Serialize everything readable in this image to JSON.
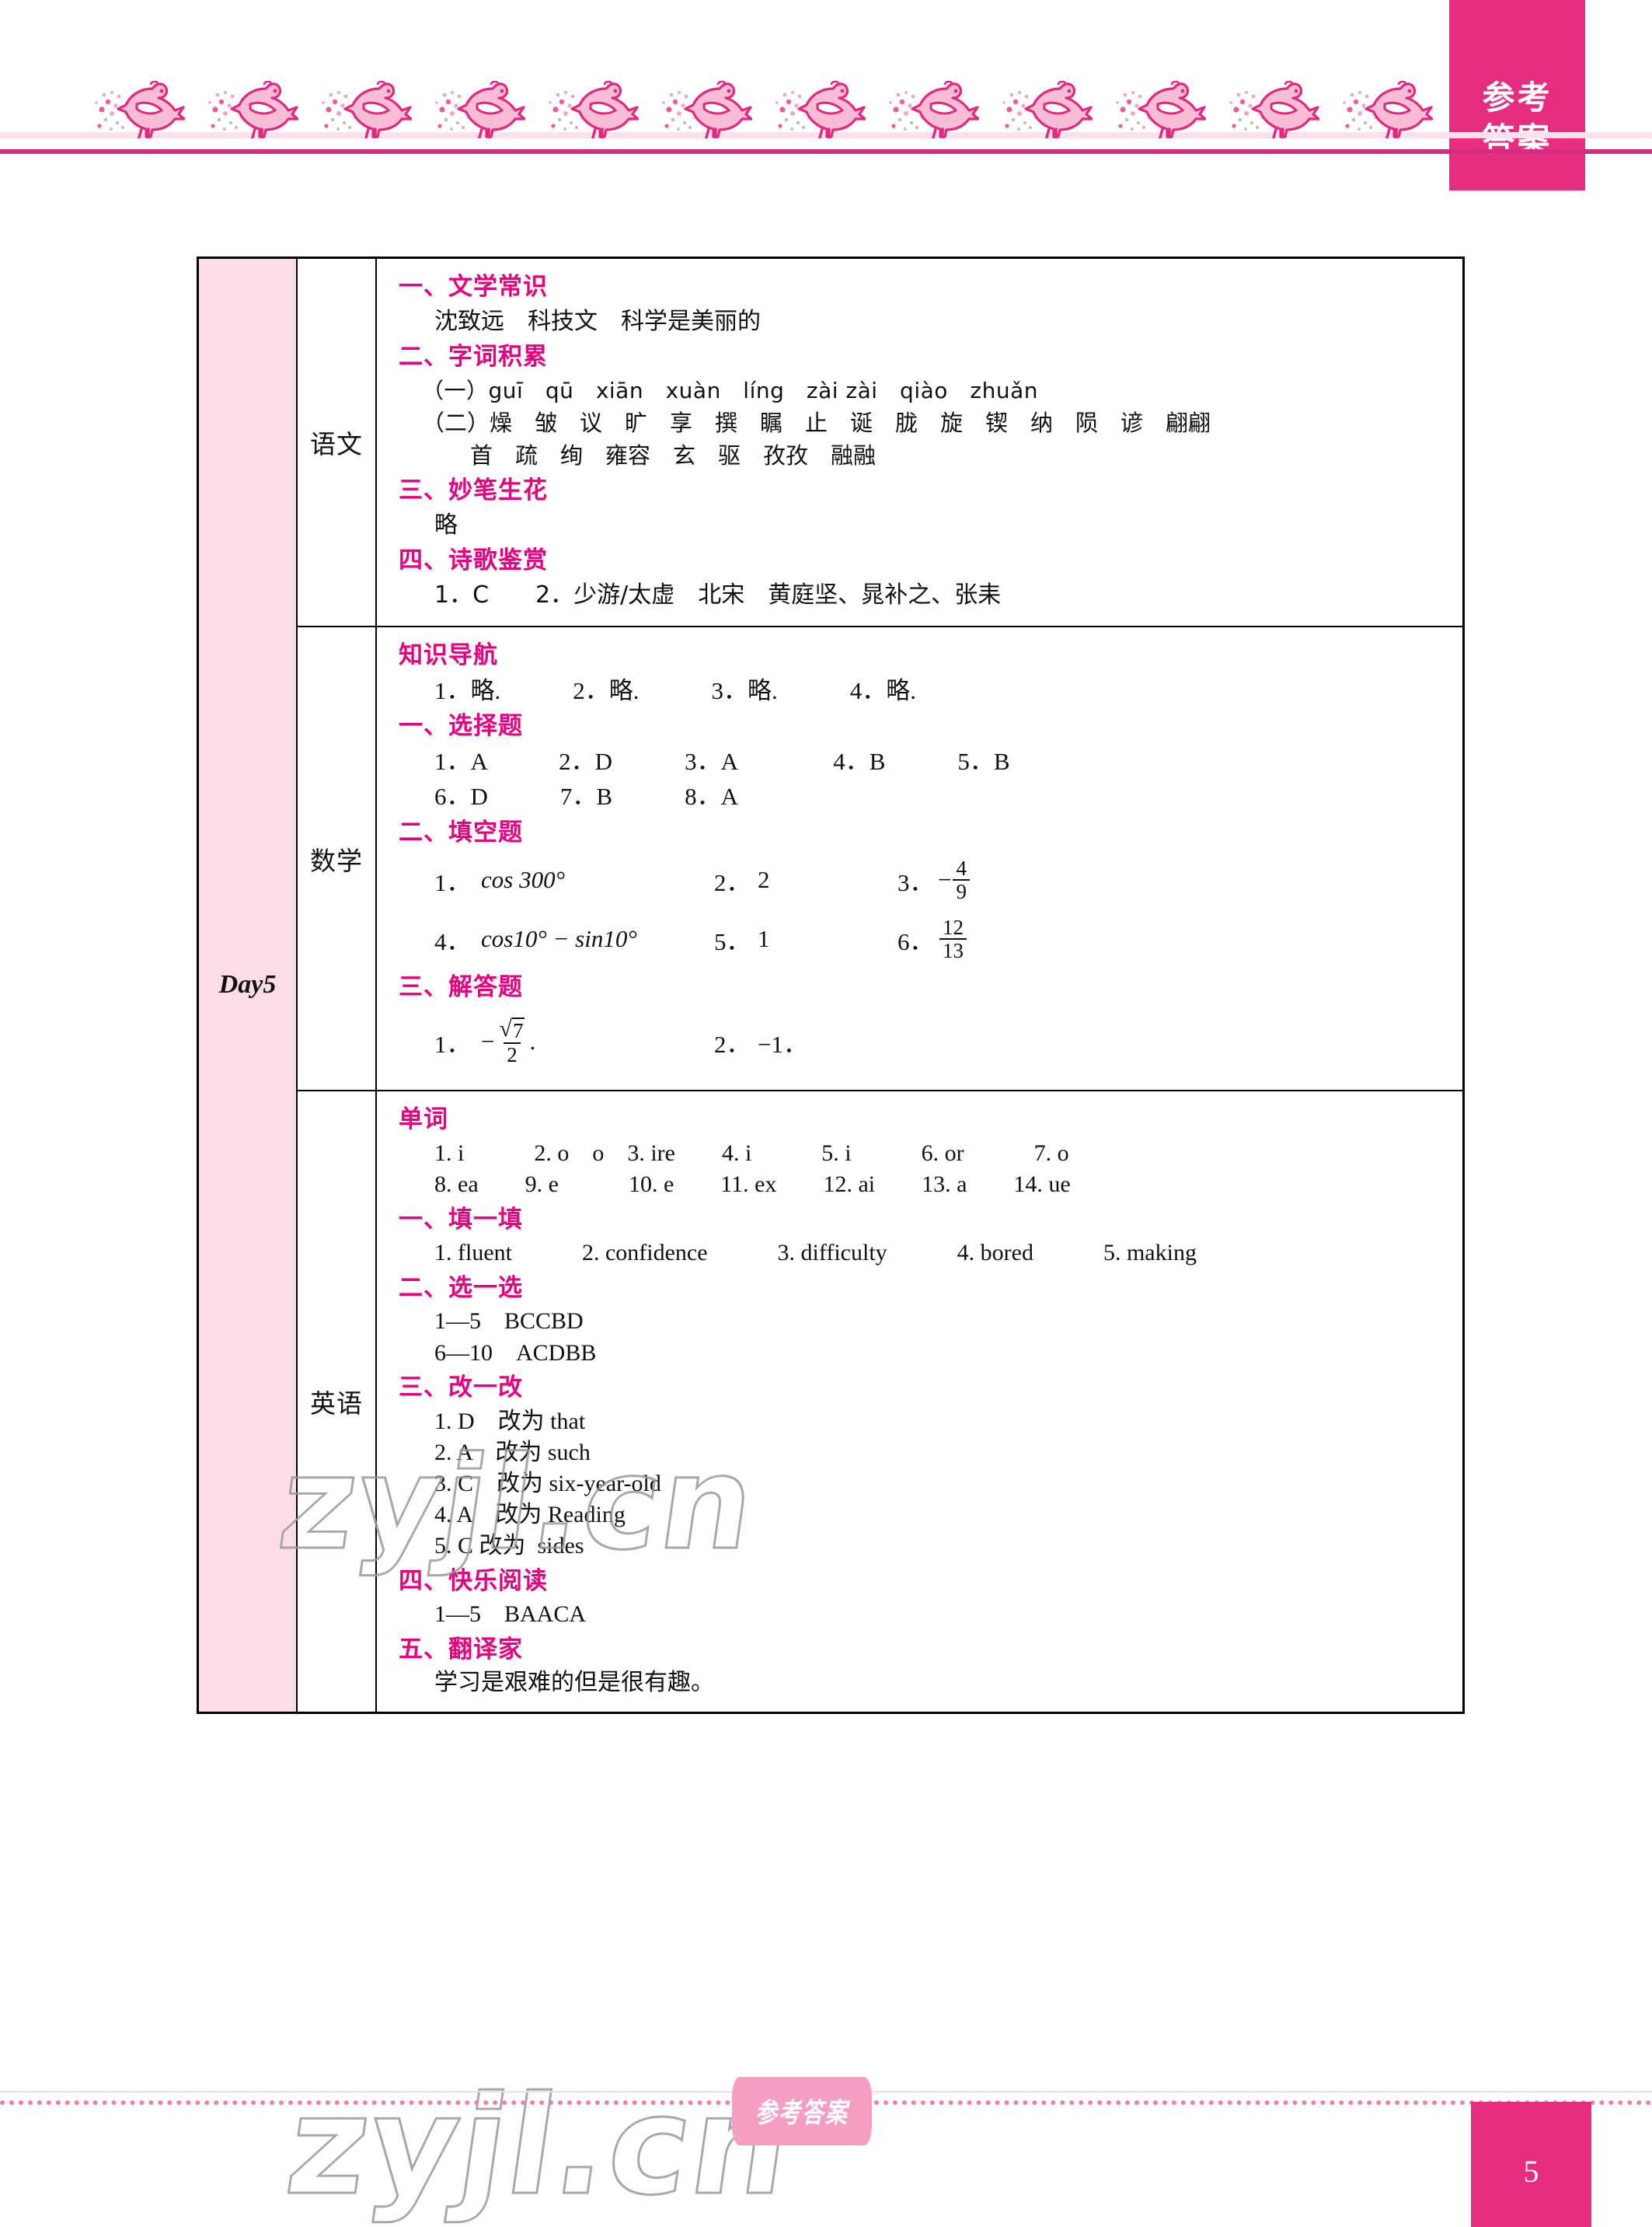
{
  "corner_tab": {
    "line1": "参考",
    "line2": "答案"
  },
  "table": {
    "day_label": "Day5",
    "subjects": {
      "chinese": "语文",
      "math": "数学",
      "english": "英语"
    }
  },
  "chinese": {
    "h1": "一、文学常识",
    "h1_answer": "沈致远　科技文　科学是美丽的",
    "h2": "二、字词积累",
    "pinyin_prefix": "（一）",
    "pinyin": "guī　qū　xiān　xuàn　líng　zài zài　qiào　zhuǎn",
    "hanzi_prefix": "（二）",
    "hanzi_line1": "燥　皱　议　旷　享　撰　瞩　止　诞　胧　旋　锲　纳　陨　谚　翩翩",
    "hanzi_line2": "首　疏　绚　雍容　玄　驱　孜孜　融融",
    "h3": "三、妙笔生花",
    "h3_answer": "略",
    "h4": "四、诗歌鉴赏",
    "h4_answer": "1．C　　2．少游/太虚　北宋　黄庭坚、晁补之、张耒"
  },
  "math": {
    "nav_head": "知识导航",
    "nav_answer": "1．略.　　　2．略.　　　3．略.　　　4．略.",
    "h1": "一、选择题",
    "choice_row1": "1．A　　　2．D　　　3．A　　　　4．B　　　5．B",
    "choice_row2": "6．D　　　7．B　　　8．A",
    "h2": "二、填空题",
    "fill": {
      "q1_label": "1．",
      "q1_value": "cos 300°",
      "q2_label": "2．",
      "q2_value": "2",
      "q3_label": "3．",
      "q3_sign": "−",
      "q3_num": "4",
      "q3_den": "9",
      "q4_label": "4．",
      "q4_value": "cos10° − sin10°",
      "q5_label": "5．",
      "q5_value": "1",
      "q6_label": "6．",
      "q6_num": "12",
      "q6_den": "13"
    },
    "h3": "三、解答题",
    "solve": {
      "q1_label": "1．",
      "q1_sign": "−",
      "q1_num_radical": "√",
      "q1_num_body": "7",
      "q1_den": "2",
      "q1_period": ".",
      "q2_label": "2．",
      "q2_value": "−1．"
    }
  },
  "english": {
    "words_head": "单词",
    "words_row1": "1. i　　　2. o　o　3. ire　　4. i　　　5. i　　　6. or　　　7. o",
    "words_row2": "8. ea　　9. e　　　10. e　　11. ex　　12. ai　　13. a　　14. ue",
    "h1": "一、填一填",
    "h1_answer": "1. fluent　　　2. confidence　　　3. difficulty　　　4. bored　　　5. making",
    "h2": "二、选一选",
    "h2_row1": "1—5　BCCBD",
    "h2_row2": "6—10　ACDBB",
    "h3": "三、改一改",
    "h3_rows": [
      "1. D　改为 that",
      "2. A　改为 such",
      "3. C　改为 six-year-old",
      "4. A　改为 Reading",
      "5. C 改为  sides"
    ],
    "h4": "四、快乐阅读",
    "h4_answer": "1—5　BAACA",
    "h5": "五、翻译家",
    "h5_answer": "学习是艰难的但是很有趣。"
  },
  "watermark": {
    "text": "zyjl.cn"
  },
  "footer": {
    "badge": "参考答案",
    "page_number": "5"
  }
}
